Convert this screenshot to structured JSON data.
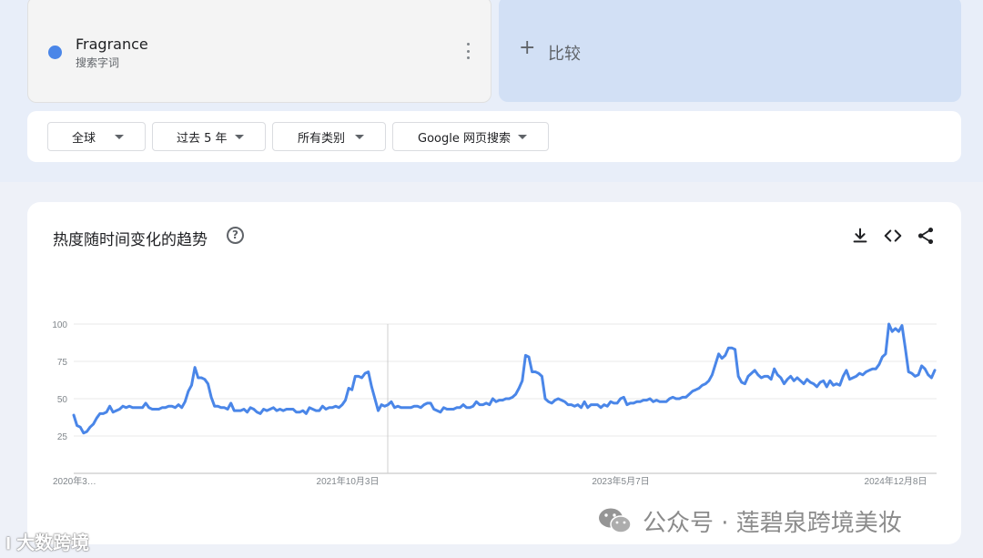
{
  "search_term": {
    "name": "Fragrance",
    "type": "搜索字词",
    "color": "#4a86e8"
  },
  "compare": {
    "plus": "+",
    "label": "比较"
  },
  "filters": [
    {
      "label": "全球"
    },
    {
      "label": "过去 5 年"
    },
    {
      "label": "所有类别"
    },
    {
      "label": "Google 网页搜索"
    }
  ],
  "chart_section": {
    "title": "热度随时间变化的趋势",
    "help_icon": "?",
    "icons": [
      "download-icon",
      "embed-code-icon",
      "share-icon"
    ]
  },
  "chart_data": {
    "type": "line",
    "ylim": [
      0,
      100
    ],
    "yticks": [
      "100",
      "75",
      "50",
      "25"
    ],
    "xtick_labels": [
      "2020年3…",
      "2021年10月3日",
      "2023年5月7日",
      "2024年12月8日"
    ],
    "grid": true,
    "series": [
      {
        "color": "#4a86e8",
        "values": [
          39,
          32,
          31,
          27,
          28,
          31,
          33,
          37,
          40,
          40,
          41,
          45,
          41,
          42,
          43,
          45,
          44,
          45,
          44,
          44,
          44,
          44,
          47,
          44,
          43,
          43,
          43,
          44,
          44,
          45,
          45,
          44,
          46,
          44,
          48,
          55,
          59,
          71,
          64,
          64,
          63,
          60,
          51,
          45,
          45,
          44,
          44,
          43,
          47,
          42,
          42,
          42,
          43,
          41,
          44,
          43,
          41,
          40,
          43,
          42,
          43,
          44,
          42,
          43,
          42,
          43,
          43,
          43,
          41,
          41,
          42,
          40,
          44,
          43,
          42,
          42,
          45,
          43,
          44,
          44,
          45,
          44,
          46,
          49,
          57,
          56,
          65,
          65,
          64,
          67,
          68,
          58,
          50,
          42,
          46,
          45,
          46,
          48,
          44,
          45,
          44,
          44,
          44,
          44,
          45,
          45,
          44,
          46,
          47,
          47,
          43,
          42,
          41,
          44,
          43,
          43,
          43,
          44,
          44,
          46,
          44,
          44,
          45,
          48,
          46,
          46,
          47,
          46,
          50,
          48,
          49,
          49,
          50,
          50,
          51,
          53,
          57,
          62,
          79,
          78,
          68,
          68,
          67,
          65,
          50,
          48,
          47,
          49,
          50,
          49,
          48,
          46,
          46,
          45,
          46,
          44,
          48,
          44,
          46,
          46,
          46,
          44,
          46,
          45,
          48,
          47,
          47,
          50,
          51,
          46,
          47,
          47,
          48,
          48,
          49,
          49,
          50,
          48,
          49,
          48,
          48,
          48,
          50,
          51,
          50,
          50,
          51,
          51,
          53,
          55,
          56,
          57,
          59,
          60,
          62,
          66,
          73,
          80,
          77,
          79,
          84,
          84,
          83,
          65,
          61,
          60,
          65,
          67,
          69,
          66,
          64,
          65,
          65,
          63,
          70,
          66,
          64,
          60,
          63,
          65,
          62,
          64,
          62,
          60,
          63,
          61,
          60,
          58,
          61,
          62,
          58,
          62,
          59,
          60,
          59,
          65,
          69,
          63,
          64,
          65,
          67,
          66,
          68,
          69,
          70,
          70,
          73,
          78,
          80,
          100,
          95,
          97,
          95,
          99,
          84,
          68,
          67,
          65,
          66,
          72,
          70,
          66,
          64,
          69
        ]
      }
    ]
  },
  "watermarks": {
    "wechat_account": "公众号 · 莲碧泉跨境美妆",
    "logo_text": "大数跨境"
  }
}
